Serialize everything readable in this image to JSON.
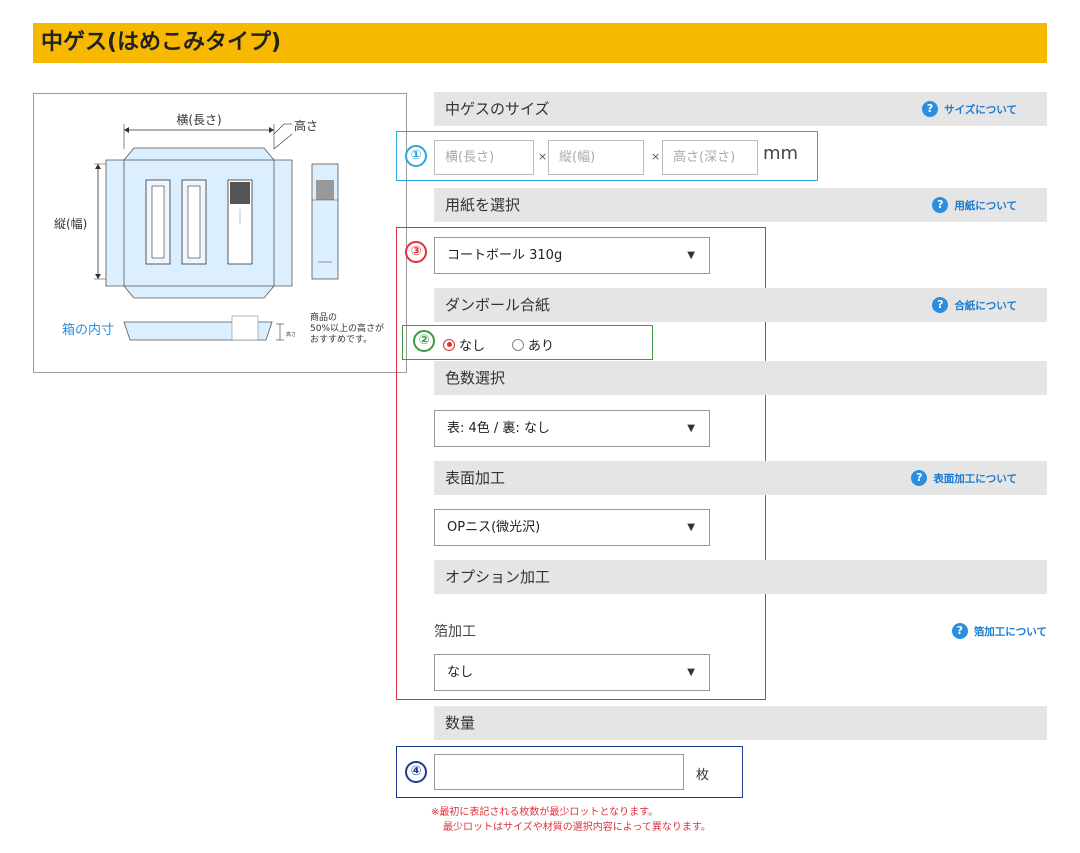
{
  "page_title": "中ゲス(はめこみタイプ)",
  "diagram": {
    "width_label": "横(長さ)",
    "height_label": "高さ",
    "depth_label": "縦(幅)",
    "inner_label": "箱の内寸",
    "small_label": "高さ",
    "note_line1": "商品の",
    "note_line2": "50%以上の高さが",
    "note_line3": "おすすめです。"
  },
  "sections": {
    "size": {
      "title": "中ゲスのサイズ",
      "help": "サイズについて"
    },
    "paper": {
      "title": "用紙を選択",
      "help": "用紙について"
    },
    "cardboard": {
      "title": "ダンボール合紙",
      "help": "合紙について"
    },
    "colors": {
      "title": "色数選択"
    },
    "surface": {
      "title": "表面加工",
      "help": "表面加工について"
    },
    "option": {
      "title": "オプション加工"
    },
    "quantity": {
      "title": "数量"
    }
  },
  "size_inputs": {
    "width_placeholder": "横(長さ)",
    "depth_placeholder": "縦(幅)",
    "height_placeholder": "高さ(深さ)",
    "times": "×",
    "unit": "mm"
  },
  "markers": {
    "m1": "①",
    "m2": "②",
    "m3": "③",
    "m4": "④"
  },
  "selects": {
    "paper": "コートボール 310g",
    "colors": "表: 4色 / 裏: なし",
    "surface": "OPニス(微光沢)",
    "foil": "なし"
  },
  "radios": {
    "none": "なし",
    "yes": "あり"
  },
  "foil": {
    "label": "箔加工",
    "help": "箔加工について"
  },
  "quantity": {
    "unit": "枚"
  },
  "notes": {
    "line1": "※最初に表記される枚数が最少ロットとなります。",
    "line2": "最少ロットはサイズや材質の選択内容によって異なります。"
  },
  "colors": {
    "title_bar": "#f7b900",
    "size_box": "#2ea4e0",
    "options_box": "#e0303a",
    "cardboard_box": "#3a9a48",
    "quantity_box": "#1e3a8a",
    "help_icon": "#2a8fe0"
  }
}
